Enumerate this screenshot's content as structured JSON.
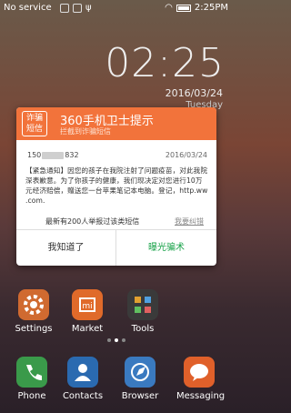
{
  "status_bar": {
    "carrier": "No service",
    "time": "2:25PM"
  },
  "lockscreen": {
    "clock": "02:25",
    "date": "2016/03/24",
    "weekday": "Tuesday"
  },
  "dialog": {
    "logo_line1": "诈骗",
    "logo_line2": "短信",
    "title": "360手机卫士提示",
    "subtitle": "拦截到诈骗短信",
    "sender_prefix": "150",
    "sender_suffix": "832",
    "message_date": "2016/03/24",
    "message_body": "【紧急通知】因您的孩子在我院注射了问题疫苗，对此我院深表歉意。为了你孩子的健康，我们现决定对您进行10万元经济赔偿，赠送您一台苹果笔记本电脑。登记，http.ww .com.",
    "report_count": "最新有200人举报过该类短信",
    "report_link": "我要纠错",
    "button_dismiss": "我知道了",
    "button_expose": "曝光骗术"
  },
  "home_row": [
    {
      "label": "Settings",
      "icon": "gear-icon",
      "color": "#d06a30"
    },
    {
      "label": "Market",
      "icon": "market-icon",
      "color": "#e06a2a"
    },
    {
      "label": "Tools",
      "icon": "tools-icon",
      "color": "#444444"
    }
  ],
  "dock": [
    {
      "label": "Phone",
      "icon": "phone-icon",
      "color": "#3a9a4a"
    },
    {
      "label": "Contacts",
      "icon": "contacts-icon",
      "color": "#2a6ab0"
    },
    {
      "label": "Browser",
      "icon": "browser-icon",
      "color": "#3a7ac0"
    },
    {
      "label": "Messaging",
      "icon": "messaging-icon",
      "color": "#e0602a"
    }
  ]
}
